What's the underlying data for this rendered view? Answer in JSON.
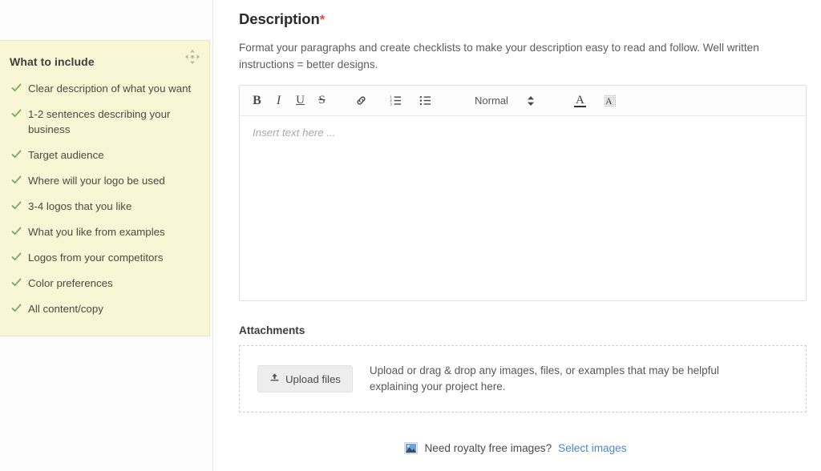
{
  "sidebar": {
    "panel_title": "What to include",
    "drag_handle_icon": "move-handle-icon",
    "check_icon": "check-icon",
    "panel_bg": "#f8f6d4",
    "check_color": "#6aa84f",
    "items": [
      {
        "label": "Clear description of what you want"
      },
      {
        "label": "1-2 sentences describing your business"
      },
      {
        "label": "Target audience"
      },
      {
        "label": "Where will your logo be used"
      },
      {
        "label": "3-4 logos that you like"
      },
      {
        "label": "What you like from examples"
      },
      {
        "label": "Logos from your competitors"
      },
      {
        "label": "Color preferences"
      },
      {
        "label": "All content/copy"
      }
    ]
  },
  "description": {
    "title": "Description",
    "required_marker": "*",
    "required_color": "#d9534f",
    "helper_text": "Format your paragraphs and create checklists to make your description easy to read and follow. Well written instructions = better designs."
  },
  "editor": {
    "toolbar": {
      "bold_label": "B",
      "italic_label": "I",
      "underline_label": "U",
      "strike_label": "S",
      "link_icon": "link-icon",
      "ordered_list_icon": "ordered-list-icon",
      "bullet_list_icon": "bullet-list-icon",
      "format_select_value": "Normal",
      "format_select_icon": "updown-stepper-icon",
      "text_color_label": "A",
      "text_color_icon": "text-color-icon",
      "background_color_label": "A",
      "background_color_icon": "background-color-icon"
    },
    "placeholder": "Insert text here ...",
    "value": ""
  },
  "attachments": {
    "title": "Attachments",
    "upload_button_label": "Upload files",
    "upload_icon": "upload-icon",
    "dropzone_text": "Upload or drag & drop any images, files, or examples that may be helpful explaining your project here."
  },
  "footer": {
    "image_icon": "photo-icon",
    "prompt_text": "Need royalty free images?",
    "link_label": "Select images",
    "link_color": "#4d87c7"
  }
}
